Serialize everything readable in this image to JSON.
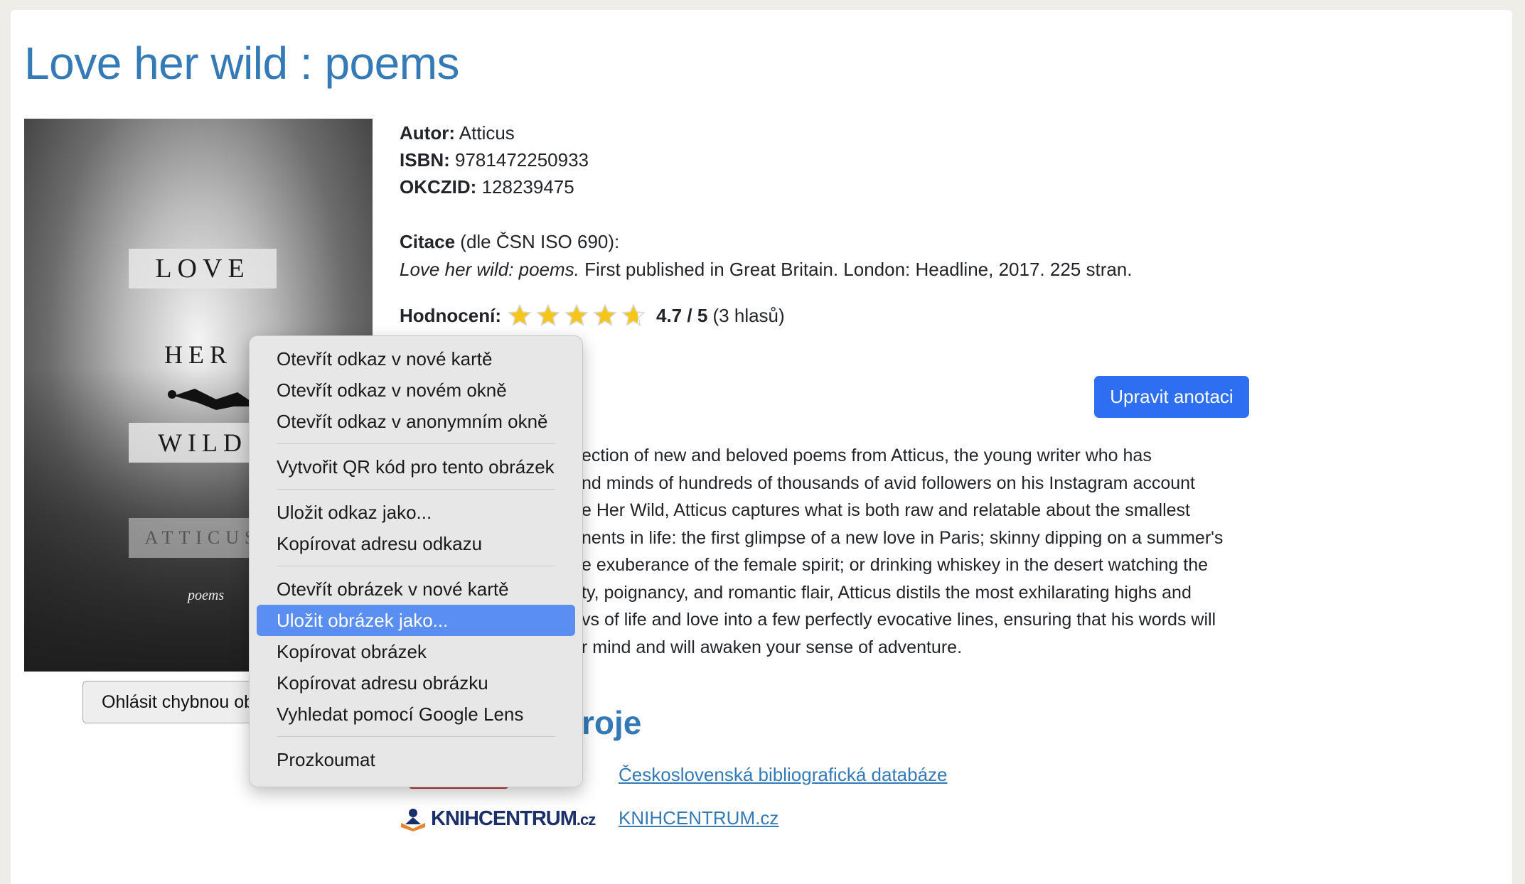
{
  "page": {
    "title": "Love her wild : poems"
  },
  "cover": {
    "line1": "LOVE",
    "line2": "HER",
    "line3": "WILD",
    "line4": "ATTICUS",
    "subtitle": "poems"
  },
  "report_button": "Ohlásit chybnou obálku",
  "details": {
    "author_label": "Autor:",
    "author": "Atticus",
    "isbn_label": "ISBN:",
    "isbn": "9781472250933",
    "okczid_label": "OKCZID:",
    "okczid": "128239475",
    "citation_label": "Citace",
    "citation_standard": "(dle ČSN ISO 690):",
    "citation_title": "Love her wild: poems.",
    "citation_rest": "First published in Great Britain. London: Headline, 2017. 225 stran.",
    "rating_label": "Hodnocení:",
    "rating_value": "4.7 / 5",
    "rating_votes": "(3 hlasů)",
    "rating_stars": 4.7
  },
  "edit_button": "Upravit anotaci",
  "annotation": {
    "lines": [
      "ection of new and beloved poems from Atticus, the young writer who has",
      "nd minds of hundreds of thousands of avid followers on his Instagram account",
      "e Her Wild, Atticus captures what is both raw and relatable about the smallest",
      "nents in life: the first glimpse of a new love in Paris; skinny dipping on a summer's",
      "e exuberance of the female spirit; or drinking whiskey in the desert watching the",
      "ty, poignancy, and romantic flair, Atticus distils the most exhilarating highs and",
      "vs of life and love into a few perfectly evocative lines, ensuring that his words will",
      "r mind and will awaken your sense of adventure."
    ]
  },
  "sources": {
    "title_visible": "roje",
    "links": [
      {
        "label": "Československá bibliografická databáze"
      },
      {
        "label": "KNIHCENTRUM.cz"
      }
    ],
    "knihcentrum_logo": "KNIHCENTRUM",
    "knihcentrum_logo_suffix": ".cz"
  },
  "context_menu": {
    "groups": [
      [
        "Otevřít odkaz v nové kartě",
        "Otevřít odkaz v novém okně",
        "Otevřít odkaz v anonymním okně"
      ],
      [
        "Vytvořit QR kód pro tento obrázek"
      ],
      [
        "Uložit odkaz jako...",
        "Kopírovat adresu odkazu"
      ],
      [
        "Otevřít obrázek v nové kartě",
        "Uložit obrázek jako...",
        "Kopírovat obrázek",
        "Kopírovat adresu obrázku",
        "Vyhledat pomocí Google Lens"
      ],
      [
        "Prozkoumat"
      ]
    ],
    "highlighted": "Uložit obrázek jako..."
  },
  "colors": {
    "link": "#337ab7",
    "primary_button": "#2d6ff0",
    "menu_highlight": "#5a8ef0",
    "star": "#f5c518"
  }
}
